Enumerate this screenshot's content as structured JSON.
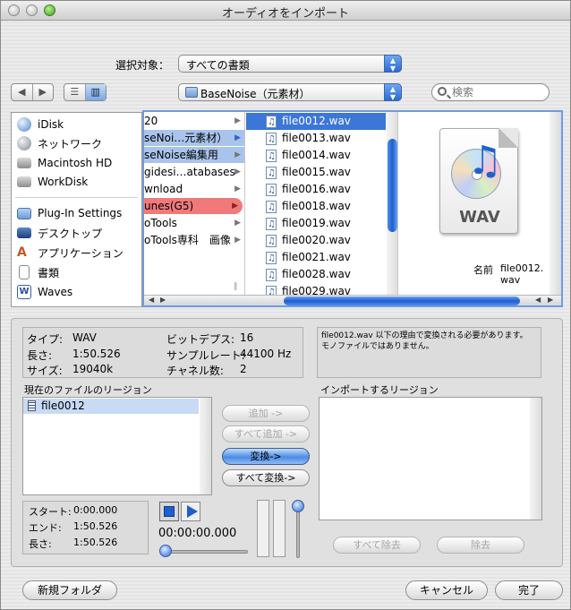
{
  "window": {
    "title": "オーディオをインポート"
  },
  "toolbar": {
    "filter_label": "選択対象：",
    "filter_value": "すべての書類",
    "location_value": "BaseNoise（元素材）",
    "search_placeholder": "検索"
  },
  "sidebar": {
    "items": [
      {
        "label": "iDisk",
        "icon": "globe-icon"
      },
      {
        "label": "ネットワーク",
        "icon": "network-icon"
      },
      {
        "label": "Macintosh HD",
        "icon": "hard-drive-icon"
      },
      {
        "label": "WorkDisk",
        "icon": "hard-drive-icon"
      },
      {
        "label": "Plug-In Settings",
        "icon": "folder-icon"
      },
      {
        "label": "デスクトップ",
        "icon": "desktop-icon"
      },
      {
        "label": "アプリケーション",
        "icon": "applications-icon"
      },
      {
        "label": "書類",
        "icon": "documents-icon"
      },
      {
        "label": "Waves",
        "icon": "waves-icon"
      }
    ]
  },
  "browser": {
    "column1": [
      "20",
      "seNoi…元素材）",
      "seNoise編集用",
      "gidesi…atabases",
      "wnload",
      "unes(G5)",
      "oTools",
      "oTools専科　画像"
    ],
    "column2": [
      "file0012.wav",
      "file0013.wav",
      "file0014.wav",
      "file0015.wav",
      "file0016.wav",
      "file0018.wav",
      "file0019.wav",
      "file0020.wav",
      "file0021.wav",
      "file0028.wav",
      "file0029.wav"
    ],
    "preview": {
      "badge": "WAV",
      "name_label": "名前",
      "name_value": "file0012.\nwav"
    }
  },
  "info": {
    "type_label": "タイプ:",
    "type_value": "WAV",
    "length_label": "長さ:",
    "length_value": "1:50.526",
    "size_label": "サイズ:",
    "size_value": "19040k",
    "bitdepth_label": "ビットデプス:",
    "bitdepth_value": "16",
    "samplerate_label": "サンプルレート:",
    "samplerate_value": "44100 Hz",
    "channels_label": "チャネル数:",
    "channels_value": "2",
    "message": "file0012.wav 以下の理由で変換される必要があります。 モノファイルではありません。"
  },
  "regions": {
    "current_label": "現在のファイルのリージョン",
    "current_items": [
      "file0012"
    ],
    "import_label": "インポートするリージョン",
    "add": "追加 ->",
    "add_all": "すべて追加 ->",
    "convert": "変換->",
    "convert_all": "すべて変換->",
    "remove_all": "すべて除去",
    "remove": "除去"
  },
  "playback": {
    "start_label": "スタート:",
    "start_value": "0:00.000",
    "end_label": "エンド:",
    "end_value": "1:50.526",
    "length_label": "長さ:",
    "length_value": "1:50.526",
    "timecode": "00:00:00.000"
  },
  "footer": {
    "new_folder": "新規フォルダ",
    "cancel": "キャンセル",
    "done": "完了"
  }
}
